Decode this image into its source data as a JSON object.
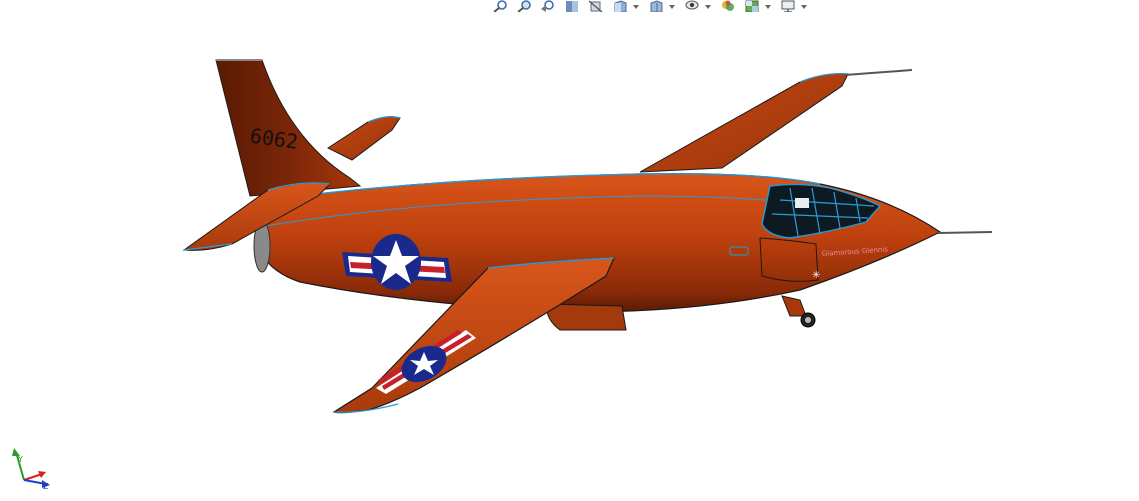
{
  "app": {
    "view": "3D model viewport"
  },
  "toolbar": {
    "items": [
      {
        "icon": "zoom-to-fit-icon",
        "has_dropdown": false
      },
      {
        "icon": "zoom-to-area-icon",
        "has_dropdown": false
      },
      {
        "icon": "previous-view-icon",
        "has_dropdown": false
      },
      {
        "icon": "section-view-icon",
        "has_dropdown": false
      },
      {
        "icon": "dynamic-annotation-icon",
        "has_dropdown": false
      },
      {
        "icon": "view-orientation-icon",
        "has_dropdown": true
      },
      {
        "icon": "display-style-icon",
        "has_dropdown": true
      },
      {
        "icon": "hide-show-items-icon",
        "has_dropdown": true
      },
      {
        "icon": "edit-appearance-icon",
        "has_dropdown": true
      },
      {
        "icon": "view-settings-icon",
        "has_dropdown": true
      }
    ]
  },
  "model": {
    "name": "Bell X-1 aircraft",
    "body_color": "#c0440f",
    "body_dark": "#6a2208",
    "edge_color": "#2a9ad6",
    "tail_number": "6062",
    "nose_art": "Glamorous Glennis",
    "insignia": {
      "blue": "#1a2a8c",
      "red": "#c8202a",
      "white": "#ffffff"
    }
  },
  "triad": {
    "x_color": "#d42020",
    "y_color": "#2a9a2a",
    "z_color": "#2040d0"
  }
}
